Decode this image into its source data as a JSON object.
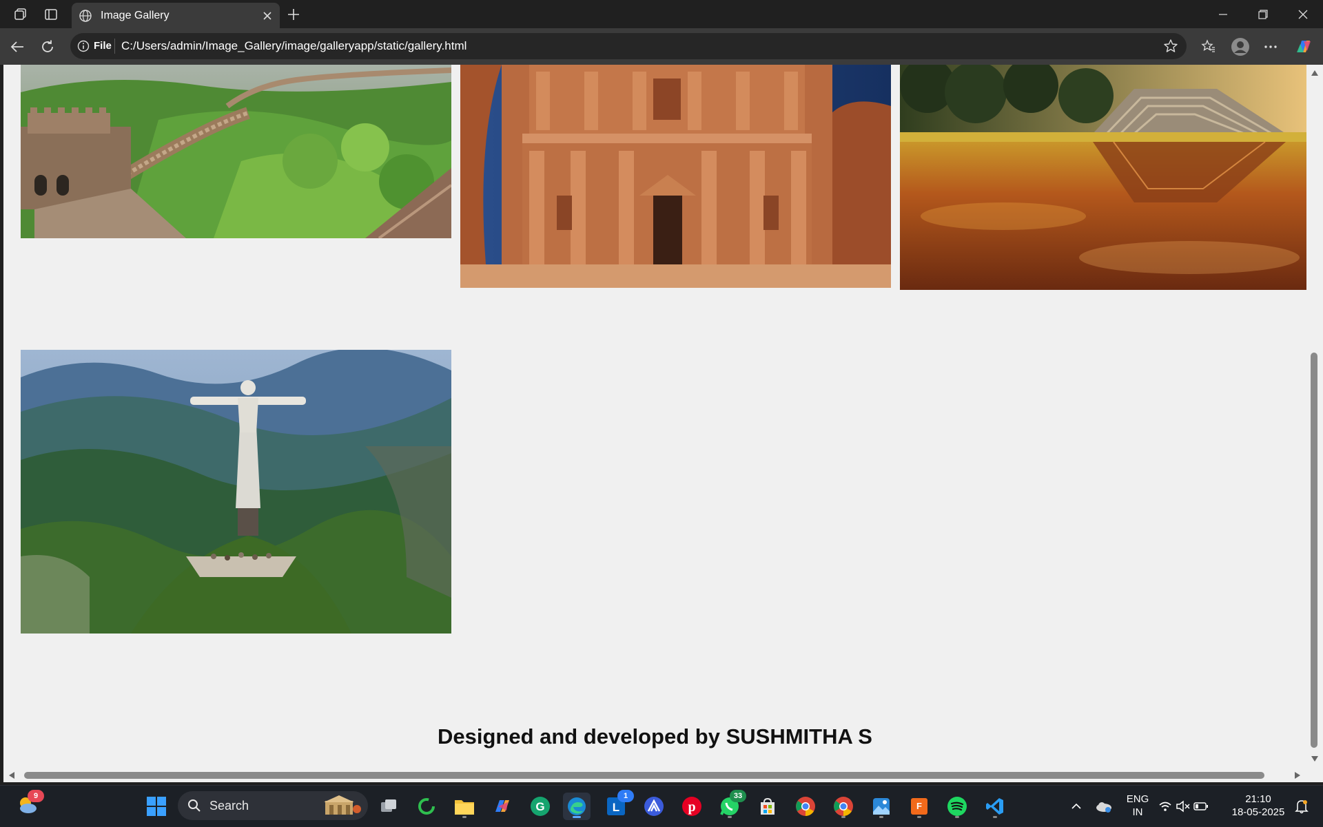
{
  "browser": {
    "tab_title": "Image Gallery",
    "address_label": "File",
    "url": "C:/Users/admin/Image_Gallery/image/galleryapp/static/gallery.html"
  },
  "page": {
    "footer_text": "Designed and developed by SUSHMITHA S",
    "background": "#f0f0f0"
  },
  "gallery": {
    "images": [
      {
        "subject": "Great Wall of China"
      },
      {
        "subject": "Petra Treasury"
      },
      {
        "subject": "Chichen Itza pyramid"
      },
      {
        "subject": "Christ the Redeemer"
      }
    ]
  },
  "taskbar": {
    "search_label": "Search",
    "weather_badge": "9",
    "linkedin_badge": "1",
    "whatsapp_badge": "33",
    "language_line1": "ENG",
    "language_line2": "IN",
    "time": "21:10",
    "date": "18-05-2025"
  },
  "colors": {
    "chrome_dark": "#202020",
    "toolbar": "#3b3b3b",
    "taskbar": "#1c2026",
    "accent": "#5aa9ff"
  }
}
